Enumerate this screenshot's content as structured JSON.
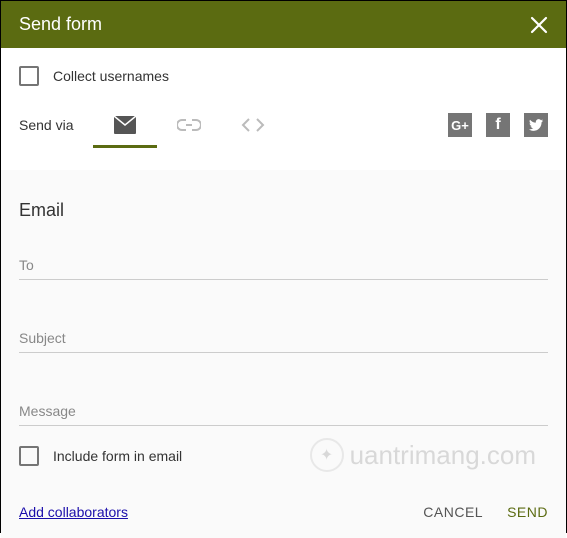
{
  "header": {
    "title": "Send form"
  },
  "collect_usernames_label": "Collect usernames",
  "send_via_label": "Send via",
  "panel": {
    "title": "Email",
    "to_label": "To",
    "subject_label": "Subject",
    "message_label": "Message"
  },
  "include_form_label": "Include form in email",
  "add_collaborators_label": "Add collaborators",
  "actions": {
    "cancel": "CANCEL",
    "send": "SEND"
  },
  "social": {
    "gplus": "G+",
    "fb": "f",
    "tw": ""
  },
  "watermark": "uantrimang.com"
}
